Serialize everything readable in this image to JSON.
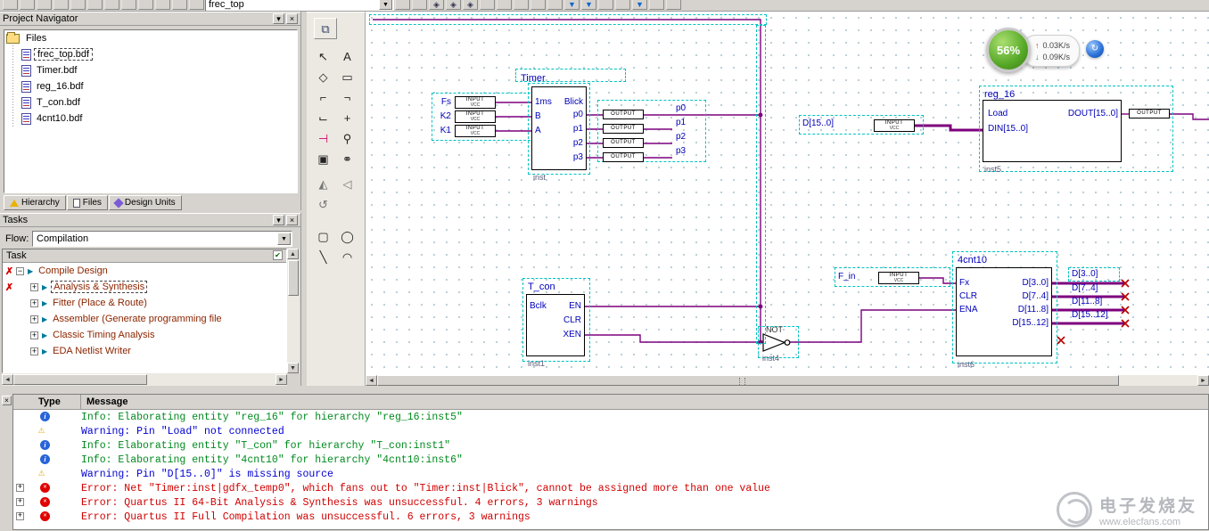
{
  "glyphs": {
    "menu": "▾",
    "close": "×",
    "dropdown": "▼",
    "plus": "+",
    "minus": "−",
    "play": "▶",
    "error_x": "✗",
    "check": "✔",
    "left": "◄",
    "right": "►",
    "up": "▲",
    "down": "▼",
    "info_i": "i",
    "warn_sign": "⚠",
    "err_sign": "✕",
    "up_arrow": "↑",
    "down_arrow": "↓",
    "refresh": "↻"
  },
  "toolbar": {
    "combo_value": "frec_top",
    "deco_icons": [
      "◈",
      "◈",
      "◈",
      "▼",
      "▼",
      "▼"
    ]
  },
  "nav": {
    "title": "Project Navigator",
    "root_label": "Files",
    "files": [
      {
        "label": "frec_top.bdf"
      },
      {
        "label": "Timer.bdf"
      },
      {
        "label": "reg_16.bdf"
      },
      {
        "label": "T_con.bdf"
      },
      {
        "label": "4cnt10.bdf"
      }
    ],
    "tabs": [
      {
        "label": "Hierarchy"
      },
      {
        "label": "Files"
      },
      {
        "label": "Design Units"
      }
    ]
  },
  "tasks": {
    "title": "Tasks",
    "flow_label": "Flow:",
    "flow_value": "Compilation",
    "header": "Task",
    "items": [
      {
        "label": "Compile Design"
      },
      {
        "label": "Analysis & Synthesis"
      },
      {
        "label": "Fitter (Place & Route)"
      },
      {
        "label": "Assembler (Generate programming file"
      },
      {
        "label": "Classic Timing Analysis"
      },
      {
        "label": "EDA Netlist Writer"
      }
    ]
  },
  "palette": {
    "tools": [
      {
        "name": "window-mode-tool",
        "glyph": "⧉"
      },
      {
        "name": "selection-tool",
        "glyph": "↖"
      },
      {
        "name": "text-tool",
        "glyph": "A"
      },
      {
        "name": "smart-connect-tool",
        "glyph": "◇"
      },
      {
        "name": "symbol-tool",
        "glyph": "▭"
      },
      {
        "name": "orthogonal-node-tool",
        "glyph": "⌐"
      },
      {
        "name": "orthogonal-conduit-tool",
        "glyph": "¬"
      },
      {
        "name": "orthogonal-bus-tool",
        "glyph": "⌙"
      },
      {
        "name": "orthogonal-pipe-tool",
        "glyph": "+"
      },
      {
        "name": "partial-line-tool",
        "glyph": "⊣"
      },
      {
        "name": "zoom-tool",
        "glyph": "⚲"
      },
      {
        "name": "full-screen-tool",
        "glyph": "▣"
      },
      {
        "name": "find-tool",
        "glyph": "⚭"
      },
      {
        "name": "flip-vertical-tool",
        "glyph": "◭"
      },
      {
        "name": "flip-horizontal-tool",
        "glyph": "◁"
      },
      {
        "name": "rotate-left-tool",
        "glyph": "↺"
      },
      {
        "name": "rectangle-tool",
        "glyph": "▢"
      },
      {
        "name": "ellipse-tool",
        "glyph": "◯"
      },
      {
        "name": "line-tool",
        "glyph": "╲"
      },
      {
        "name": "arc-tool",
        "glyph": "◠"
      }
    ]
  },
  "schematic": {
    "blocks": {
      "timer": {
        "title": "Timer",
        "p_1ms": "1ms",
        "p_blick": "Blick",
        "p_b": "B",
        "p_a": "A",
        "p0": "p0",
        "p1": "p1",
        "p2": "p2",
        "p3": "p3",
        "inst": "inst"
      },
      "reg16": {
        "title": "reg_16",
        "load": "Load",
        "dout": "DOUT[15..0]",
        "din": "DIN[15..0]",
        "inst": "inst5"
      },
      "tcon": {
        "title": "T_con",
        "bclk": "Bclk",
        "en": "EN",
        "clr": "CLR",
        "xen": "XEN",
        "inst": "inst1"
      },
      "cnt10": {
        "title": "4cnt10",
        "fx": "Fx",
        "clr": "CLR",
        "ena": "ENA",
        "d30": "D[3..0]",
        "d74": "D[7..4]",
        "d118": "D[11..8]",
        "d1512": "D[15..12]",
        "inst": "inst6"
      },
      "notgate": {
        "label": "NOT",
        "inst": "inst4"
      }
    },
    "pins": {
      "input_text": "INPUT",
      "vcc_text": "VCC",
      "output_text": "OUTPUT"
    },
    "labels": {
      "fs": "Fs",
      "k2": "K2",
      "k1": "K1",
      "p0": "p0",
      "p1": "p1",
      "p2": "p2",
      "p3": "p3",
      "d_bus": "D[15..0]",
      "f_in": "F_in",
      "bus0": "D[3..0]",
      "bus1": "D[7..4]",
      "bus2": "D[11..8]",
      "bus3": "D[15..12]"
    },
    "progress": {
      "percent": "56%",
      "up_speed": "0.03K/s",
      "down_speed": "0.09K/s"
    }
  },
  "messages": {
    "col_type": "Type",
    "col_message": "Message",
    "rows": [
      {
        "type": "info",
        "text": "Info: Elaborating entity \"reg_16\" for hierarchy \"reg_16:inst5\""
      },
      {
        "type": "warning",
        "text": "Warning: Pin \"Load\" not connected"
      },
      {
        "type": "info",
        "text": "Info: Elaborating entity \"T_con\" for hierarchy \"T_con:inst1\""
      },
      {
        "type": "info",
        "text": "Info: Elaborating entity \"4cnt10\" for hierarchy \"4cnt10:inst6\""
      },
      {
        "type": "warning",
        "text": "Warning: Pin \"D[15..0]\" is missing source"
      },
      {
        "type": "error",
        "text": "Error: Net \"Timer:inst|gdfx_temp0\", which fans out to \"Timer:inst|Blick\", cannot be assigned more than one value"
      },
      {
        "type": "error",
        "text": "Error: Quartus II 64-Bit Analysis & Synthesis was unsuccessful. 4 errors, 3 warnings"
      },
      {
        "type": "error",
        "text": "Error: Quartus II Full Compilation was unsuccessful. 6 errors, 3 warnings"
      }
    ]
  },
  "watermark": {
    "brand": "电子发烧友",
    "site": "www.elecfans.com"
  }
}
